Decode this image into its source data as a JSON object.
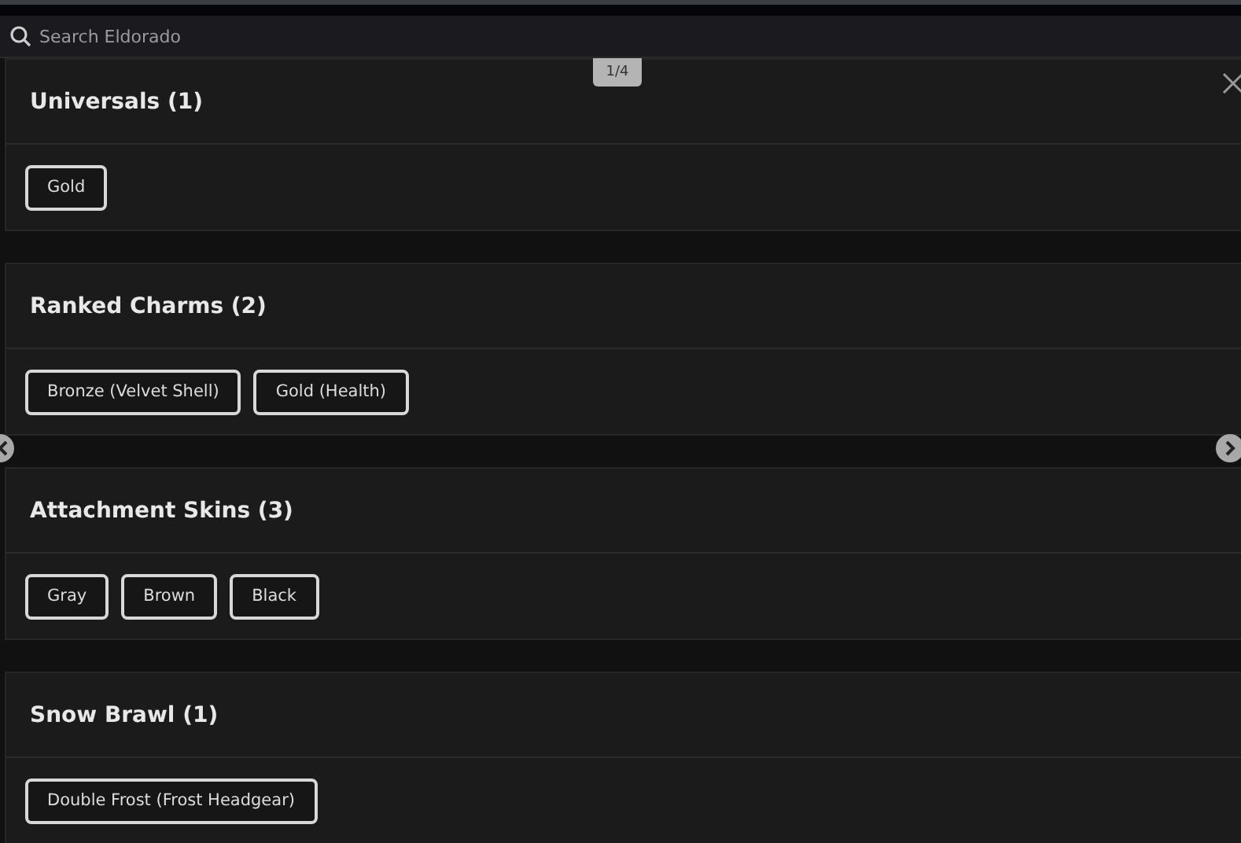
{
  "search": {
    "placeholder": "Search Eldorado"
  },
  "counter": "1/4",
  "sections": [
    {
      "title": "Universals (1)",
      "items": [
        "Gold"
      ]
    },
    {
      "title": "Ranked Charms (2)",
      "items": [
        "Bronze (Velvet Shell)",
        "Gold (Health)"
      ]
    },
    {
      "title": "Attachment Skins (3)",
      "items": [
        "Gray",
        "Brown",
        "Black"
      ]
    },
    {
      "title": "Snow Brawl (1)",
      "items": [
        "Double Frost (Frost Headgear)"
      ]
    }
  ]
}
